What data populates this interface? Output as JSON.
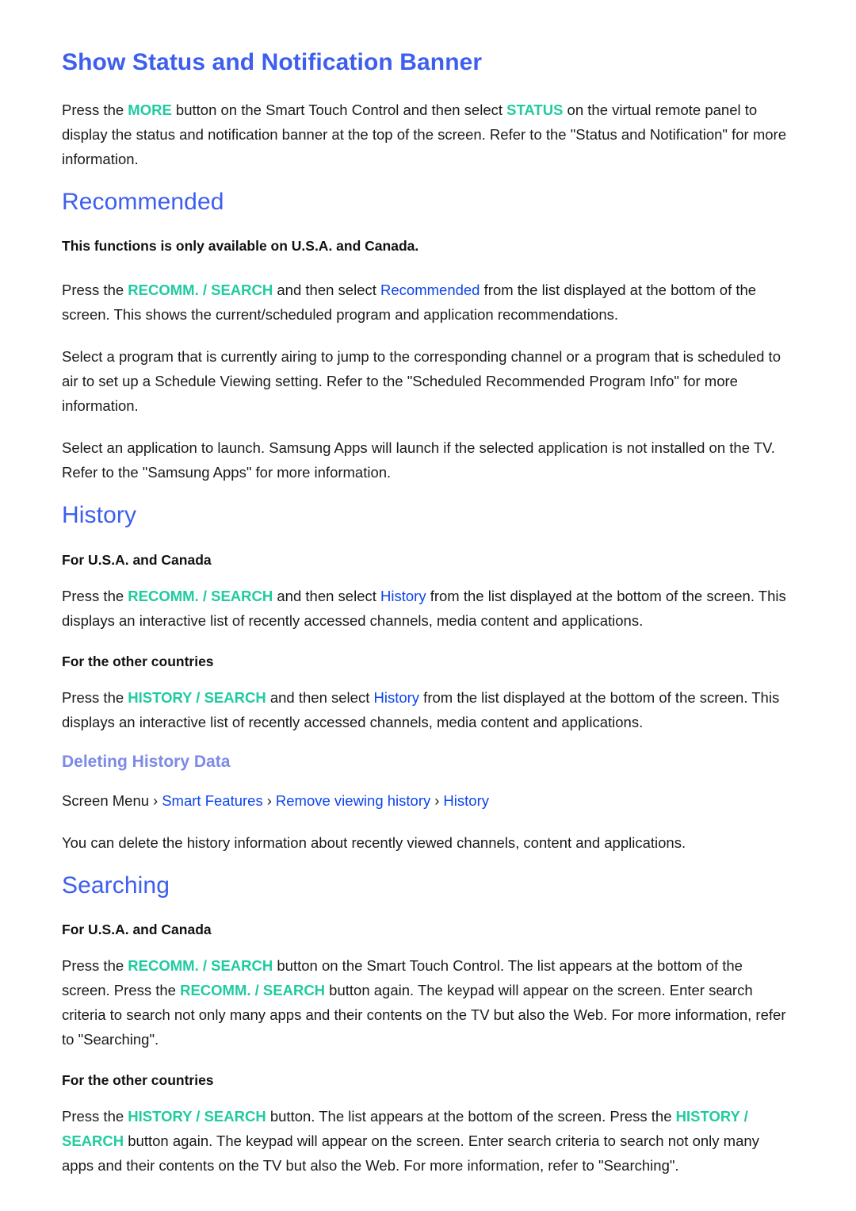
{
  "document": {
    "background_color": "#ffffff",
    "heading_color": "#3d5eee",
    "subheading_color": "#7c8ae8",
    "key_color": "#1fcba0",
    "menu_color": "#0d44ee",
    "body_color": "#1a1a1a"
  },
  "sections": {
    "banner": {
      "heading": "Show Status and Notification Banner",
      "p1": {
        "t1": "Press the ",
        "key1": "MORE",
        "t2": " button on the Smart Touch Control and then select ",
        "key2": "STATUS",
        "t3": " on the virtual remote panel to display the status and notification banner at the top of the screen. Refer to the \"Status and Notification\" for more information."
      }
    },
    "recommended": {
      "heading": "Recommended",
      "availability_note": "This functions is only available on U.S.A. and Canada.",
      "p1": {
        "t1": "Press the ",
        "key1": "RECOMM. / SEARCH",
        "t2": " and then select ",
        "menu1": "Recommended",
        "t3": " from the list displayed at the bottom of the screen. This shows the current/scheduled program and application recommendations."
      },
      "p2": "Select a program that is currently airing to jump to the corresponding channel or a program that is scheduled to air to set up a Schedule Viewing setting. Refer to the \"Scheduled Recommended Program Info\" for more information.",
      "p3": "Select an application to launch. Samsung Apps will launch if the selected application is not installed on the TV. Refer to the \"Samsung Apps\" for more information."
    },
    "history": {
      "heading": "History",
      "label_usa": "For U.S.A. and Canada",
      "p_usa": {
        "t1": "Press the ",
        "key1": "RECOMM. / SEARCH",
        "t2": " and then select ",
        "menu1": "History",
        "t3": " from the list displayed at the bottom of the screen. This displays an interactive list of recently accessed channels, media content and applications."
      },
      "label_other": "For the other countries",
      "p_other": {
        "t1": "Press the ",
        "key1": "HISTORY / SEARCH",
        "t2": " and then select ",
        "menu1": "History",
        "t3": " from the list displayed at the bottom of the screen. This displays an interactive list of recently accessed channels, media content and applications."
      },
      "subsection": {
        "heading": "Deleting History Data",
        "breadcrumb": {
          "root": "Screen Menu",
          "sep": "›",
          "item1": "Smart Features",
          "item2": "Remove viewing history",
          "item3": "History"
        },
        "p1": "You can delete the history information about recently viewed channels, content and applications."
      }
    },
    "searching": {
      "heading": "Searching",
      "label_usa": "For U.S.A. and Canada",
      "p_usa": {
        "t1": "Press the ",
        "key1": "RECOMM. / SEARCH",
        "t2": " button on the Smart Touch Control. The list appears at the bottom of the screen. Press the ",
        "key2": "RECOMM. / SEARCH",
        "t3": " button again. The keypad will appear on the screen. Enter search criteria to search not only many apps and their contents on the TV but also the Web. For more information, refer to \"Searching\"."
      },
      "label_other": "For the other countries",
      "p_other": {
        "t1": "Press the ",
        "key1": "HISTORY / SEARCH",
        "t2": " button. The list appears at the bottom of the screen. Press the ",
        "key2": "HISTORY / SEARCH",
        "t3": " button again. The keypad will appear on the screen. Enter search criteria to search not only many apps and their contents on the TV but also the Web. For more information, refer to \"Searching\"."
      }
    }
  }
}
